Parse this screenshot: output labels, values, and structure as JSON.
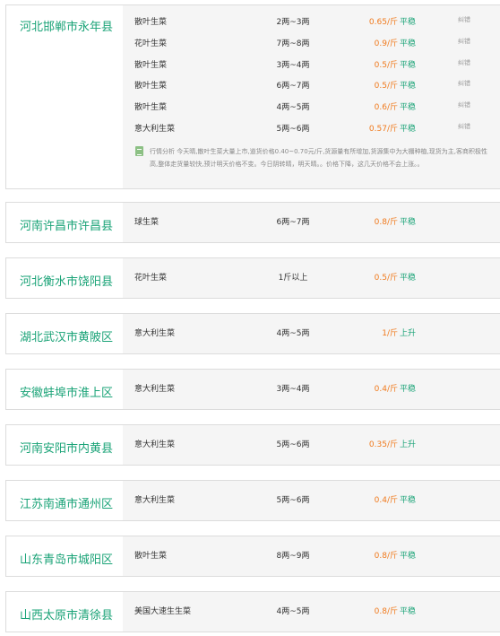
{
  "colors": {
    "region": "#1aa377",
    "price": "#f07a1d",
    "trend": "#1aa377",
    "border": "#dcdcdc",
    "row_bg": "#f5f5f5"
  },
  "entries": [
    {
      "region": "河北邯郸市永年县",
      "rows": [
        {
          "variety": "散叶生菜",
          "size": "2两~3两",
          "price": "0.65/斤",
          "trend": "平稳",
          "action": "纠错"
        },
        {
          "variety": "花叶生菜",
          "size": "7两~8两",
          "price": "0.9/斤",
          "trend": "平稳",
          "action": "纠错"
        },
        {
          "variety": "散叶生菜",
          "size": "3两~4两",
          "price": "0.5/斤",
          "trend": "平稳",
          "action": "纠错"
        },
        {
          "variety": "散叶生菜",
          "size": "6两~7两",
          "price": "0.5/斤",
          "trend": "平稳",
          "action": "纠错"
        },
        {
          "variety": "散叶生菜",
          "size": "4两~5两",
          "price": "0.6/斤",
          "trend": "平稳",
          "action": "纠错"
        },
        {
          "variety": "意大利生菜",
          "size": "5两~6两",
          "price": "0.57/斤",
          "trend": "平稳",
          "action": "纠错"
        }
      ],
      "analysis": "行情分析 今天晴,散叶生菜大量上市,道货价格0.40~0.70元/斤,货源量有所增加,货源集中为大棚种植,现货为主,客商积极性高,整体走货量较快,预计明天价格不变。今日阴转晴，明天晴。。价格下降，这几天价格不会上涨。。"
    },
    {
      "region": "河南许昌市许昌县",
      "rows": [
        {
          "variety": "球生菜",
          "size": "6两~7两",
          "price": "0.8/斤",
          "trend": "平稳"
        }
      ]
    },
    {
      "region": "河北衡水市饶阳县",
      "rows": [
        {
          "variety": "花叶生菜",
          "size": "1斤以上",
          "price": "0.5/斤",
          "trend": "平稳"
        }
      ]
    },
    {
      "region": "湖北武汉市黄陂区",
      "rows": [
        {
          "variety": "意大利生菜",
          "size": "4两~5两",
          "price": "1/斤",
          "trend": "上升"
        }
      ]
    },
    {
      "region": "安徽蚌埠市淮上区",
      "rows": [
        {
          "variety": "意大利生菜",
          "size": "3两~4两",
          "price": "0.4/斤",
          "trend": "平稳"
        }
      ]
    },
    {
      "region": "河南安阳市内黄县",
      "rows": [
        {
          "variety": "意大利生菜",
          "size": "5两~6两",
          "price": "0.35/斤",
          "trend": "上升"
        }
      ]
    },
    {
      "region": "江苏南通市通州区",
      "rows": [
        {
          "variety": "意大利生菜",
          "size": "5两~6两",
          "price": "0.4/斤",
          "trend": "平稳"
        }
      ]
    },
    {
      "region": "山东青岛市城阳区",
      "rows": [
        {
          "variety": "散叶生菜",
          "size": "8两~9两",
          "price": "0.8/斤",
          "trend": "平稳"
        }
      ]
    },
    {
      "region": "山西太原市清徐县",
      "rows": [
        {
          "variety": "美国大速生生菜",
          "size": "4两~5两",
          "price": "0.8/斤",
          "trend": "平稳"
        }
      ]
    }
  ]
}
